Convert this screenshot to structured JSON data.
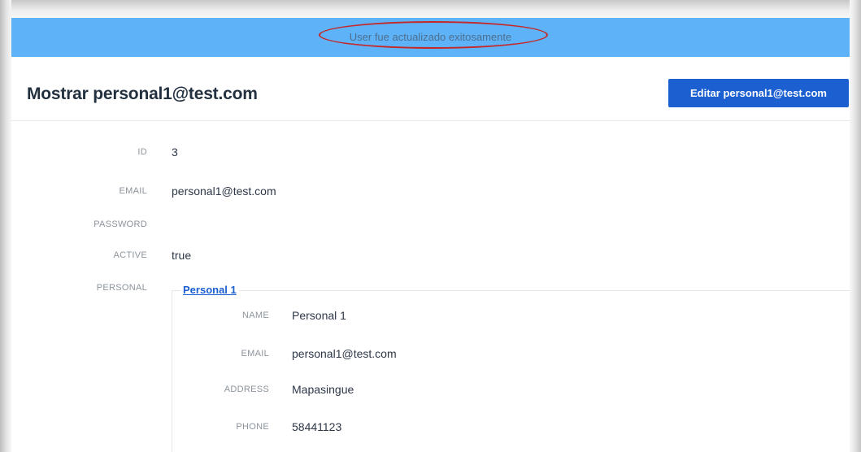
{
  "flash": {
    "message": "User fue actualizado exitosamente"
  },
  "header": {
    "title": "Mostrar personal1@test.com",
    "edit_button_label": "Editar personal1@test.com"
  },
  "fields": {
    "id": {
      "label": "ID",
      "value": "3"
    },
    "email": {
      "label": "EMAIL",
      "value": "personal1@test.com"
    },
    "password": {
      "label": "PASSWORD",
      "value": ""
    },
    "active": {
      "label": "ACTIVE",
      "value": "true"
    },
    "personal": {
      "label": "PERSONAL",
      "link": "Personal 1"
    }
  },
  "personal": {
    "name": {
      "label": "NAME",
      "value": "Personal 1"
    },
    "email": {
      "label": "EMAIL",
      "value": "personal1@test.com"
    },
    "address": {
      "label": "ADDRESS",
      "value": "Mapasingue"
    },
    "phone": {
      "label": "PHONE",
      "value": "58441123"
    }
  },
  "colors": {
    "flash_bg": "#5eb2f7",
    "primary": "#1b5fd1",
    "annotation": "#c62828"
  }
}
